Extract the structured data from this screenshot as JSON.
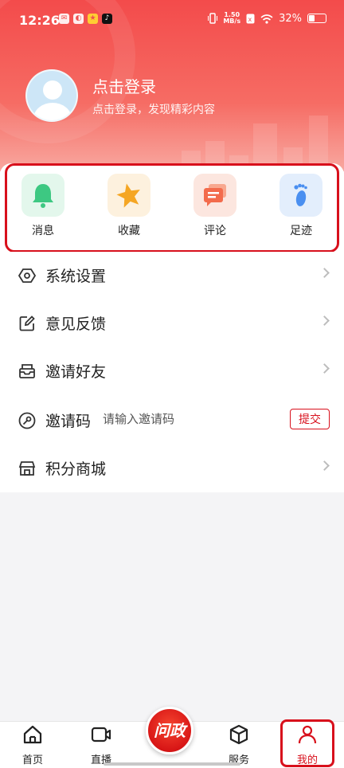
{
  "status_bar": {
    "time": "12:26",
    "speed_top": "1.50",
    "speed_bottom": "MB/s",
    "battery": "32%"
  },
  "profile": {
    "login_title": "点击登录",
    "login_subtitle": "点击登录，发现精彩内容"
  },
  "quick_actions": [
    {
      "label": "消息",
      "icon": "bell-icon",
      "color": "#3dc882"
    },
    {
      "label": "收藏",
      "icon": "star-icon",
      "color": "#f5a623"
    },
    {
      "label": "评论",
      "icon": "comment-icon",
      "color": "#f36b4c"
    },
    {
      "label": "足迹",
      "icon": "footprint-icon",
      "color": "#4a8ff0"
    }
  ],
  "menu": {
    "settings": "系统设置",
    "feedback": "意见反馈",
    "invite_friends": "邀请好友",
    "invite_code": "邀请码",
    "invite_placeholder": "请输入邀请码",
    "submit": "提交",
    "points_mall": "积分商城"
  },
  "tabbar": {
    "home": "首页",
    "live": "直播",
    "center": "问政",
    "service": "服务",
    "mine": "我的"
  },
  "colors": {
    "brand": "#d8101c",
    "header": "#f34b4b"
  }
}
